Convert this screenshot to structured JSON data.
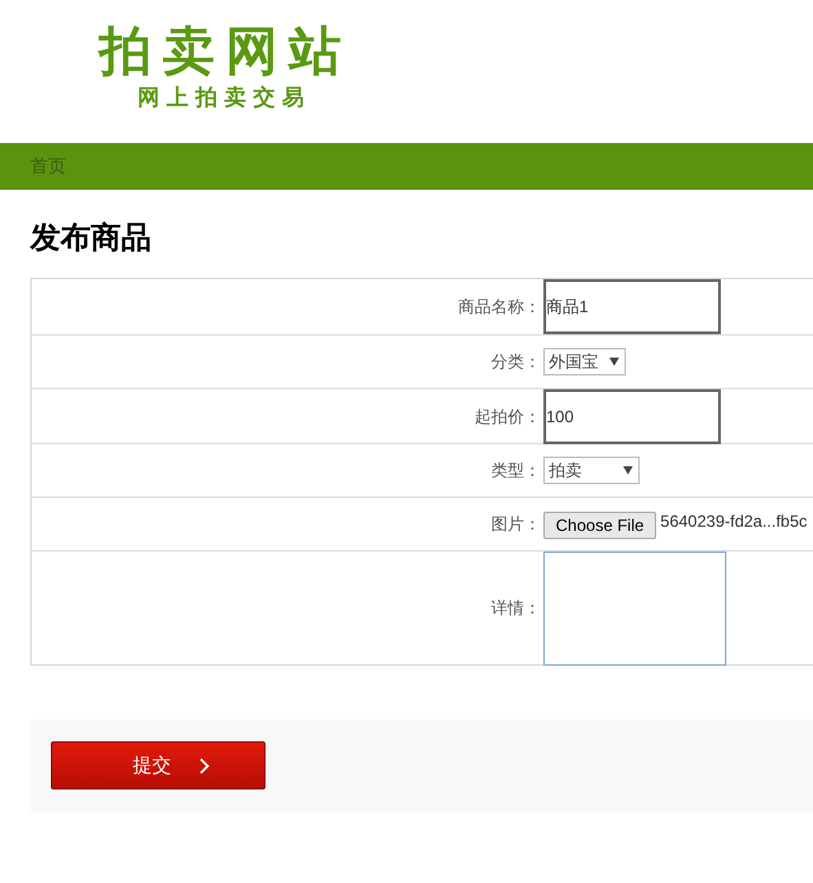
{
  "logo": {
    "title": "拍卖网站",
    "subtitle": "网上拍卖交易"
  },
  "nav": [
    {
      "label": "首页"
    }
  ],
  "heading": "发布商品",
  "form": {
    "rows": [
      {
        "kind": "text",
        "label": "商品名称：",
        "value": "商品1"
      },
      {
        "kind": "select",
        "label": "分类：",
        "value": "外国宝"
      },
      {
        "kind": "text",
        "label": "起拍价：",
        "value": "100"
      },
      {
        "kind": "select",
        "label": "类型：",
        "value": "拍卖"
      },
      {
        "kind": "file",
        "label": "图片：",
        "button": "Choose File",
        "file_name": "5640239-fd2a...fb5c"
      },
      {
        "kind": "textarea",
        "label": "详情：",
        "focused": true
      }
    ]
  },
  "submit": {
    "label": "提交"
  }
}
